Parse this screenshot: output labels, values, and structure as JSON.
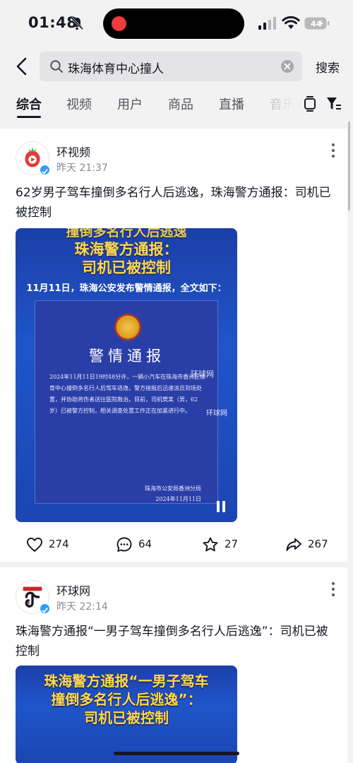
{
  "status_bar": {
    "time": "01:48",
    "battery": "44"
  },
  "search": {
    "back": "back",
    "query": "珠海体育中心撞人",
    "submit_label": "搜索"
  },
  "tabs": [
    {
      "label": "综合"
    },
    {
      "label": "视频"
    },
    {
      "label": "用户"
    },
    {
      "label": "商品"
    },
    {
      "label": "直播"
    },
    {
      "label": "音乐"
    }
  ],
  "posts": [
    {
      "author": "环视频",
      "time": "昨天 21:37",
      "title": "62岁男子驾车撞倒多名行人后逃逸，珠海警方通报：司机已被控制",
      "thumb": {
        "headline_top": "撞倒多名行人后逃逸",
        "headline_1": "珠海警方通报：",
        "headline_2": "司机已被控制",
        "intro": "11月11日，珠海公安发布警情通报，全文如下：",
        "notice_title": "警情通报",
        "notice_body": "2024年11月11日19时48分许，一辆小汽车在珠海市香洲区体育中心撞倒多名行人后驾车逃逸，警方接报后迅速派员到场处置，并协助将伤者送往医院救治。目前，司机樊某（男，62岁）已被警方控制，相关调查处置工作正在加紧进行中。",
        "notice_org": "珠海市公安局香洲分局",
        "notice_date": "2024年11月11日",
        "watermark": "环球网",
        "watermark_2": "环球网"
      },
      "likes": "274",
      "comments": "64",
      "favorites": "27",
      "shares": "267"
    },
    {
      "author": "环球网",
      "time": "昨天 22:14",
      "title": "珠海警方通报“一男子驾车撞倒多名行人后逃逸”：司机已被控制",
      "thumb": {
        "headline_1": "珠海警方通报“一男子驾车",
        "headline_2": "撞倒多名行人后逃逸”：",
        "headline_3": "司机已被控制"
      }
    }
  ],
  "colors": {
    "accent_blue": "#1f55c9",
    "headline_yellow": "#ffd84a",
    "verified_blue": "#2f9cff",
    "record_red": "#ee3b3b"
  },
  "icons": [
    "bell-off-icon",
    "signal-icon",
    "wifi-icon",
    "battery-icon",
    "back-icon",
    "search-icon",
    "clear-icon",
    "layout-icon",
    "filter-icon",
    "more-icon",
    "heart-icon",
    "comment-icon",
    "star-icon",
    "share-icon",
    "pause-icon"
  ]
}
